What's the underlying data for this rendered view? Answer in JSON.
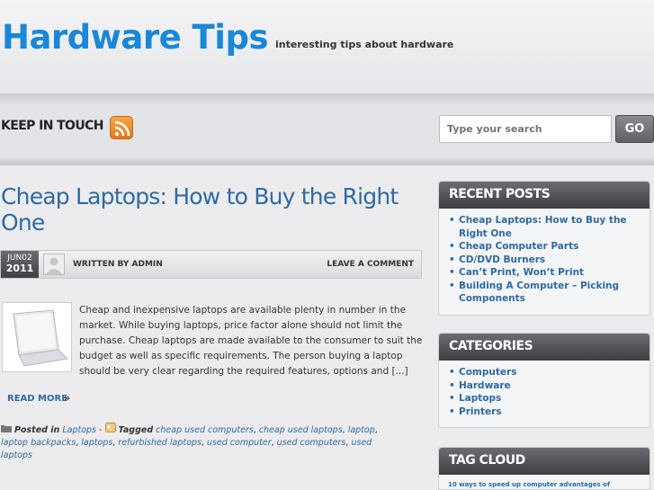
{
  "header": {
    "site_title": "Hardware Tips",
    "tagline": "interesting tips about hardware"
  },
  "topbar": {
    "keep_in_touch": "KEEP IN TOUCH",
    "search_placeholder": "Type your search",
    "go_label": "GO"
  },
  "post": {
    "title": "Cheap Laptops: How to Buy the Right One",
    "date_month_day": "JUN02",
    "date_year": "2011",
    "written_by": "WRITTEN BY ADMIN",
    "leave_comment": "LEAVE A COMMENT",
    "excerpt": "Cheap and inexpensive laptops are available plenty in number in the market. While buying laptops, price factor alone should not limit the purchase.  Cheap laptops are made available to the consumer to suit the budget as well as specific requirements.  The person buying a laptop should be very clear regarding the required features, options and [...]",
    "read_more": "READ MORE",
    "read_more_arrow": "»",
    "posted_in_label": "Posted in",
    "category": "Laptops",
    "separator": "-",
    "tagged_label": "Tagged",
    "tags": [
      "cheap used computers",
      "cheap used laptops",
      "laptop",
      "laptop backpacks",
      "laptops",
      "refurbished laptops",
      "used computer",
      "used computers",
      "used laptops"
    ]
  },
  "sidebar": {
    "recent_posts": {
      "title": "RECENT POSTS",
      "items": [
        "Cheap Laptops: How to Buy the Right One",
        "Cheap Computer Parts",
        "CD/DVD Burners",
        "Can’t Print, Won’t Print",
        "Building A Computer – Picking Components"
      ]
    },
    "categories": {
      "title": "CATEGORIES",
      "items": [
        "Computers",
        "Hardware",
        "Laptops",
        "Printers"
      ]
    },
    "tag_cloud": {
      "title": "TAG CLOUD",
      "text": "10 ways to speed up computer advantages of"
    }
  },
  "colors": {
    "accent": "#1a87d8",
    "link": "#2e6aa3",
    "widget_header": "#4a4c50",
    "rss": "#f08a24"
  },
  "icons": [
    "rss-icon",
    "avatar-icon",
    "laptop-image",
    "folder-icon",
    "tag-icon"
  ]
}
